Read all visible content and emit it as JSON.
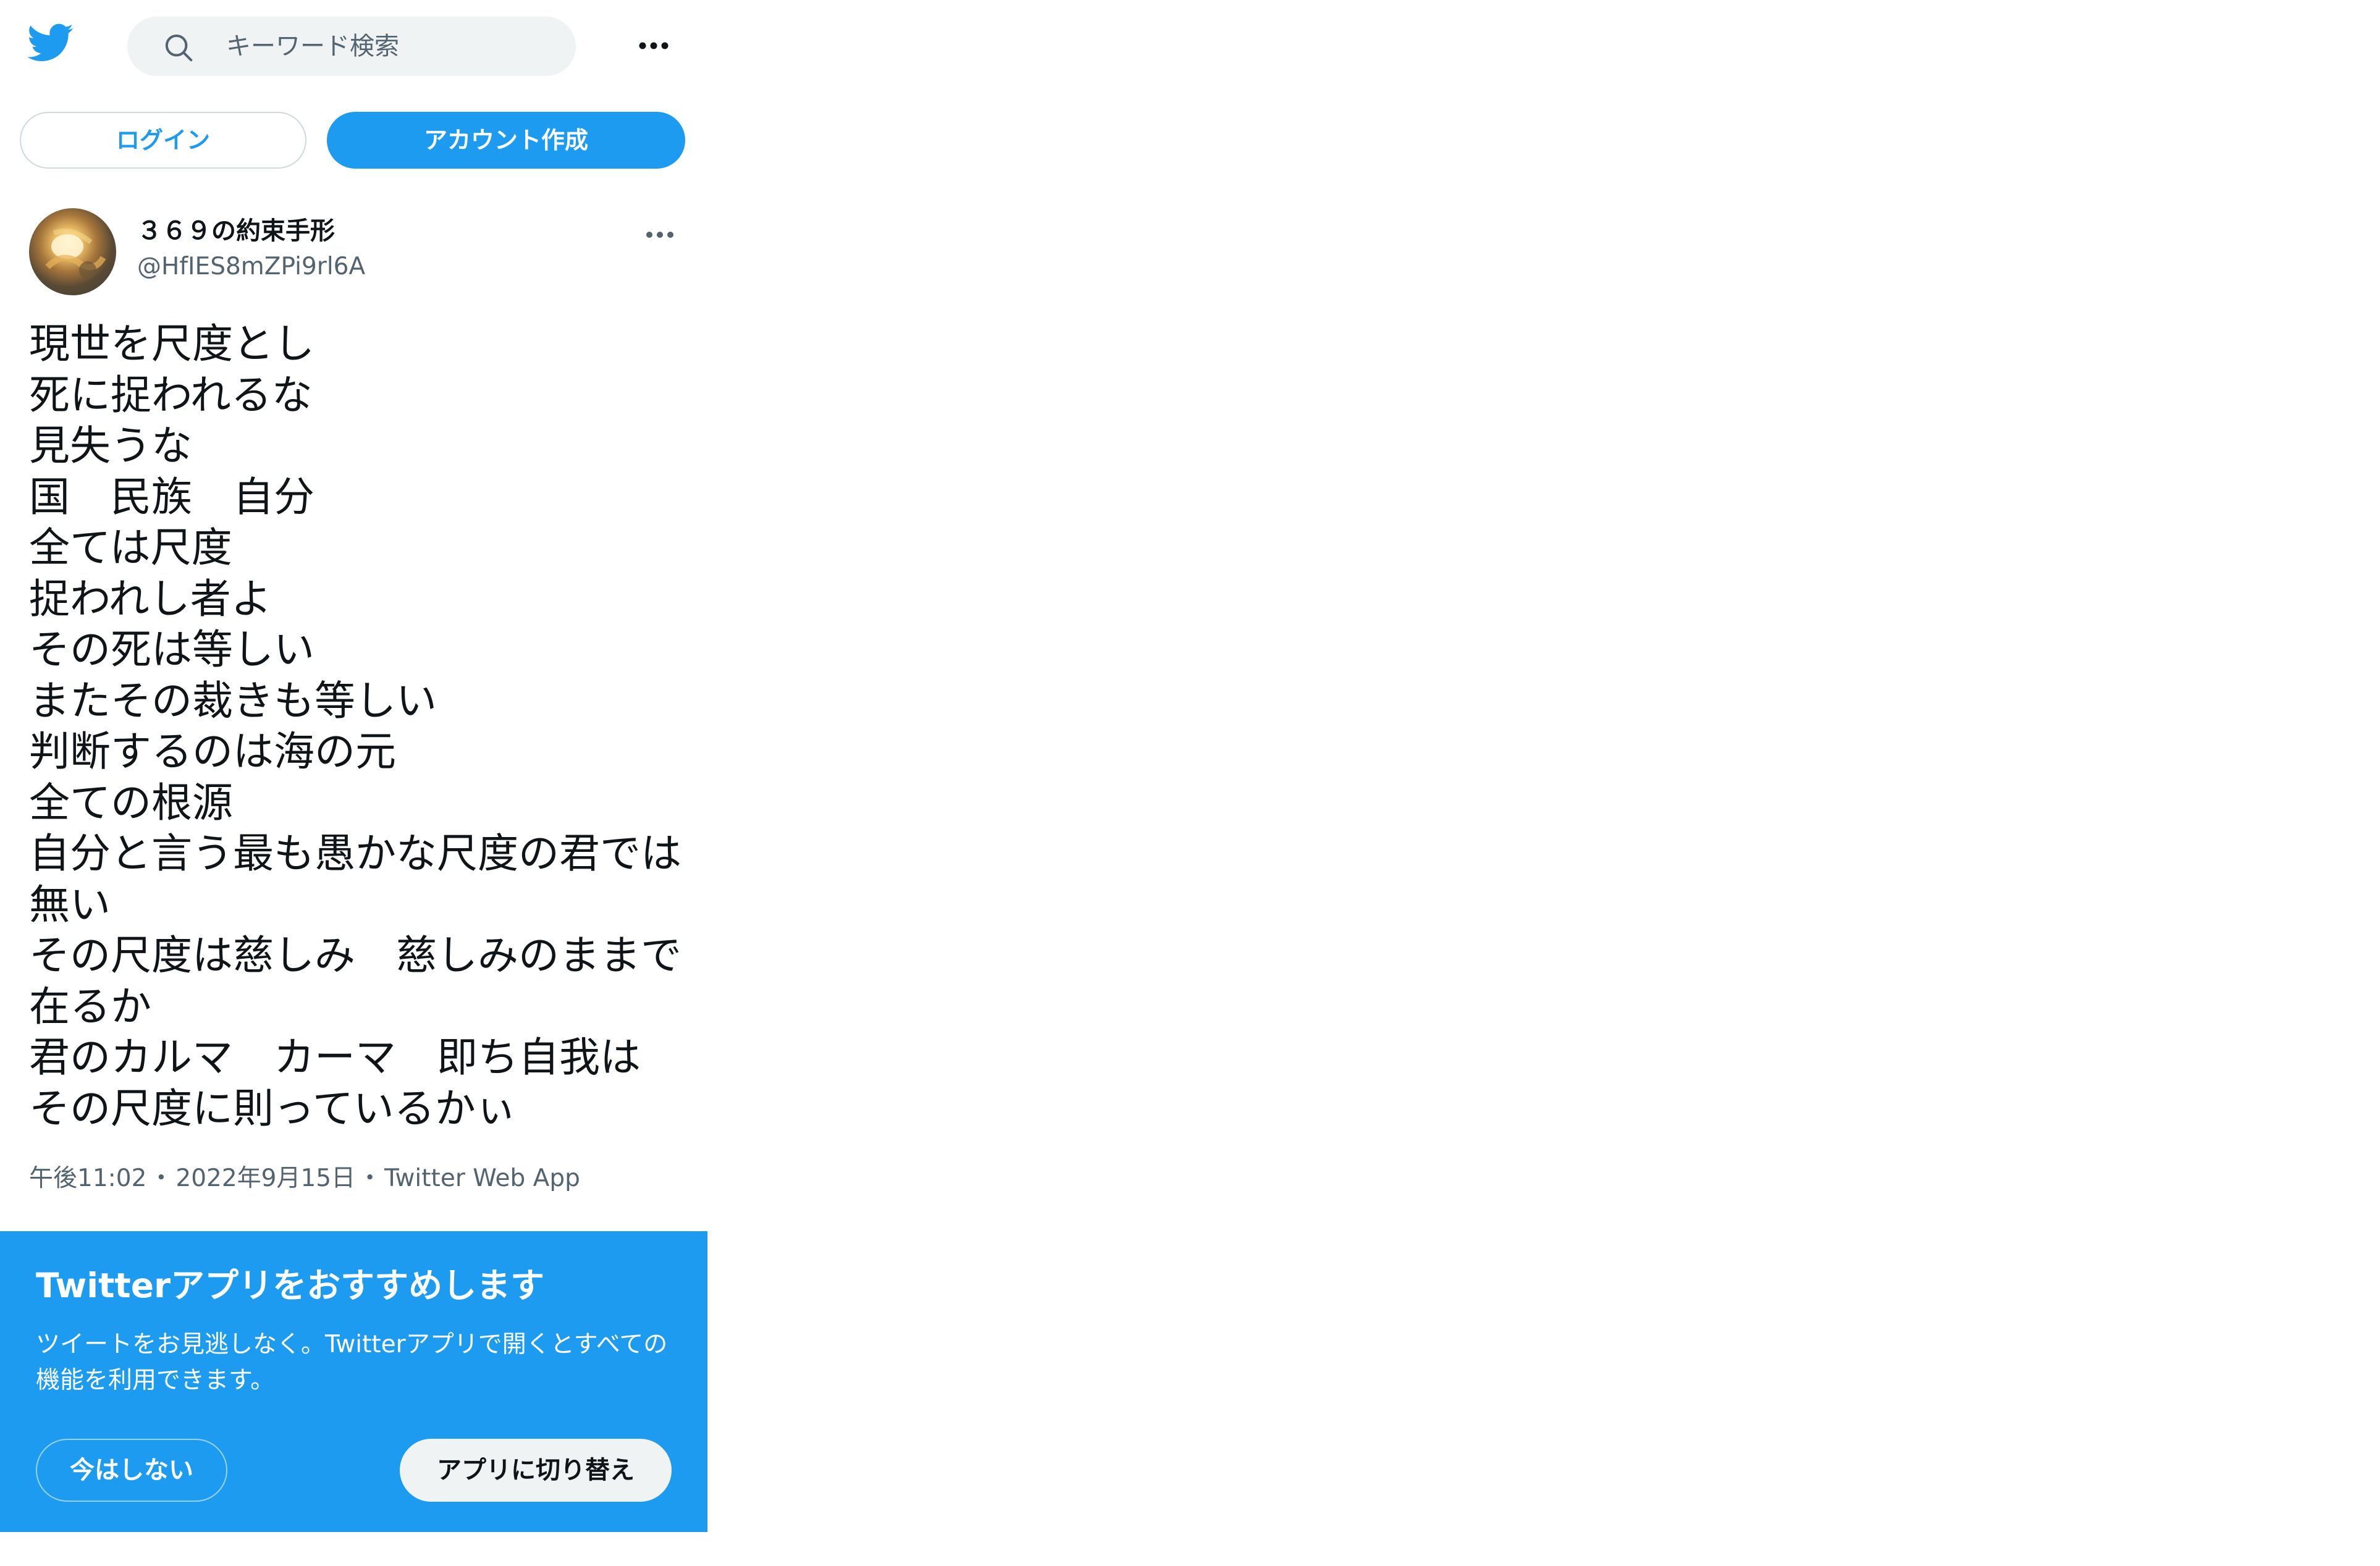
{
  "header": {
    "logo_icon": "twitter-bird-icon",
    "search": {
      "icon": "search-icon",
      "placeholder": "キーワード検索"
    },
    "more_icon": "more-horizontal-icon"
  },
  "auth": {
    "login_label": "ログイン",
    "signup_label": "アカウント作成"
  },
  "tweet": {
    "author": {
      "display_name": "３６９の約束手形",
      "handle": "@HfIES8mZPi9rl6A"
    },
    "more_icon": "more-horizontal-icon",
    "lines": [
      "現世を尺度とし",
      "死に捉われるな",
      "見失うな",
      "国　民族　自分",
      "全ては尺度",
      "捉われし者よ",
      "その死は等しい",
      "またその裁きも等しい",
      "判断するのは海の元",
      "全ての根源",
      "自分と言う最も愚かな尺度の君では無い",
      "その尺度は慈しみ　慈しみのままで在るか",
      "君のカルマ　カーマ　即ち自我は",
      "その尺度に則っているかぃ"
    ],
    "meta": {
      "time": "午後11:02",
      "separator": "・",
      "date": "2022年9月15日",
      "source": "Twitter Web App"
    }
  },
  "promo": {
    "title": "Twitterアプリをおすすめします",
    "body": "ツイートをお見逃しなく。Twitterアプリで開くとすべての機能を利用できます。",
    "not_now_label": "今はしない",
    "switch_label": "アプリに切り替え"
  },
  "colors": {
    "brand_blue": "#1d9bf0",
    "text_primary": "#0f1419",
    "text_secondary": "#536471",
    "search_bg": "#eff3f4"
  }
}
